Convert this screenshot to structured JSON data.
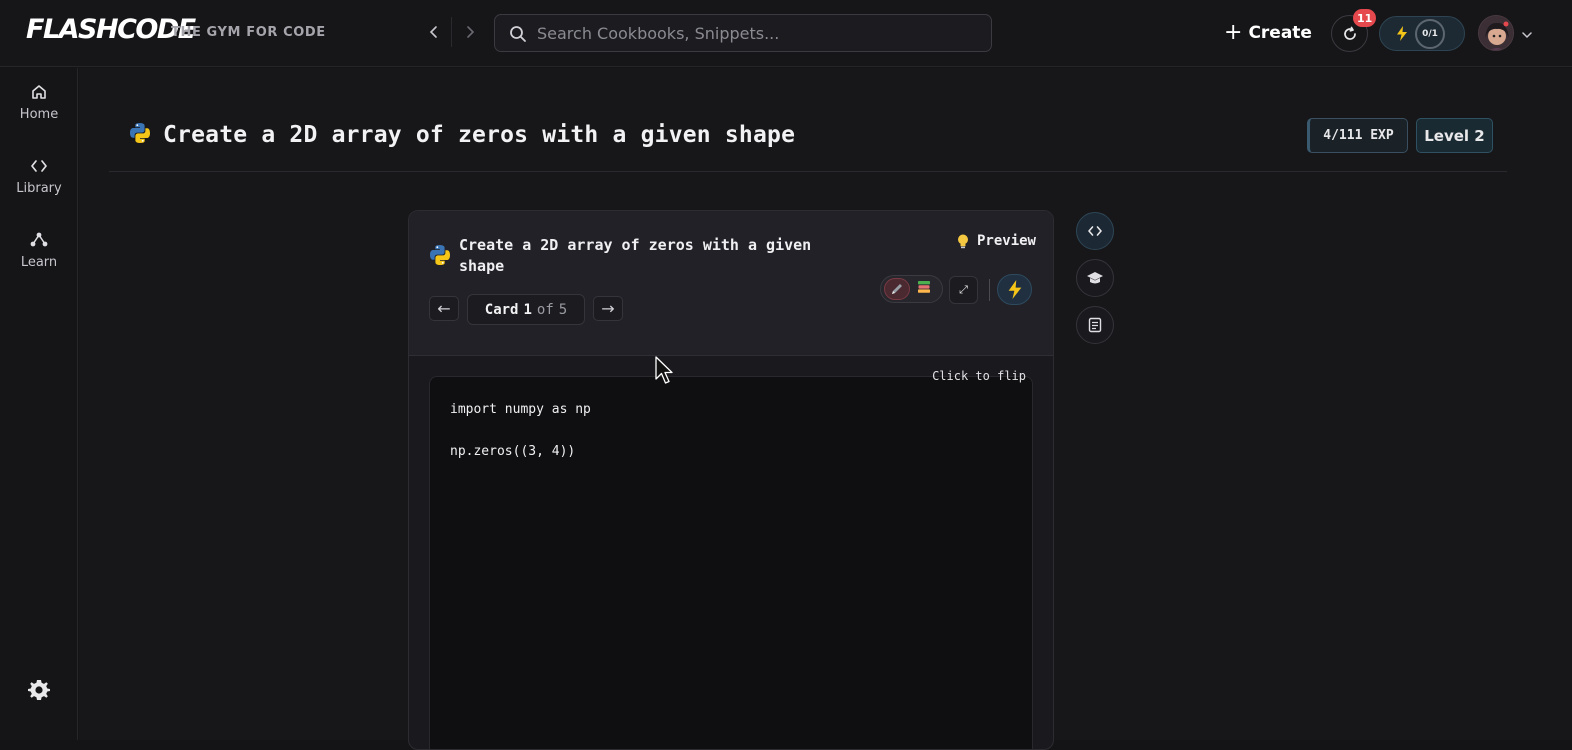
{
  "header": {
    "logo": "FLASHCODE",
    "tagline": "THE GYM FOR CODE",
    "search_placeholder": "Search Cookbooks, Snippets...",
    "create_label": "Create",
    "notification_count": "11",
    "streak_progress": "0/1"
  },
  "sidebar": {
    "items": [
      {
        "label": "Home",
        "icon": "home-icon"
      },
      {
        "label": "Library",
        "icon": "code-icon"
      },
      {
        "label": "Learn",
        "icon": "learn-icon"
      }
    ],
    "settings_icon": "gear-icon"
  },
  "page": {
    "title": "Create a 2D array of zeros with a given shape",
    "exp": "4/111 EXP",
    "level": "Level 2"
  },
  "card": {
    "title": "Create a 2D array of zeros with a given shape",
    "preview_label": "Preview",
    "pager": {
      "prefix": "Card",
      "current": "1",
      "of": "of",
      "total": "5"
    },
    "flip_hint": "Click to flip",
    "code": "import numpy as np\n\nnp.zeros((3, 4))"
  },
  "colors": {
    "background": "#141417",
    "accent_blue": "#2e4a5e",
    "badge_red": "#e5484d",
    "bolt_yellow": "#f5c518"
  }
}
